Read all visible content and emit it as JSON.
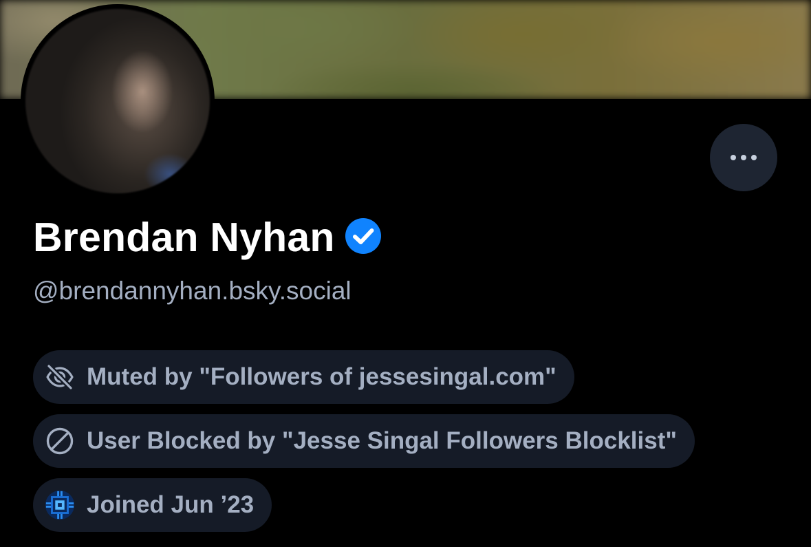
{
  "profile": {
    "display_name": "Brendan Nyhan",
    "handle": "@brendannyhan.bsky.social",
    "verified_icon": "verified-check-icon",
    "more_icon": "more-horizontal-icon"
  },
  "labels": [
    {
      "icon": "eye-slash-icon",
      "text": "Muted by \"Followers of jessesingal.com\""
    },
    {
      "icon": "block-icon",
      "text": "User Blocked by \"Jesse Singal Followers Blocklist\""
    },
    {
      "icon": "bluesky-joined-icon",
      "text": "Joined Jun ’23"
    }
  ],
  "colors": {
    "background": "#000000",
    "pill_background": "#151b27",
    "muted_text": "#a4afc2",
    "verified_blue": "#1083fe"
  }
}
